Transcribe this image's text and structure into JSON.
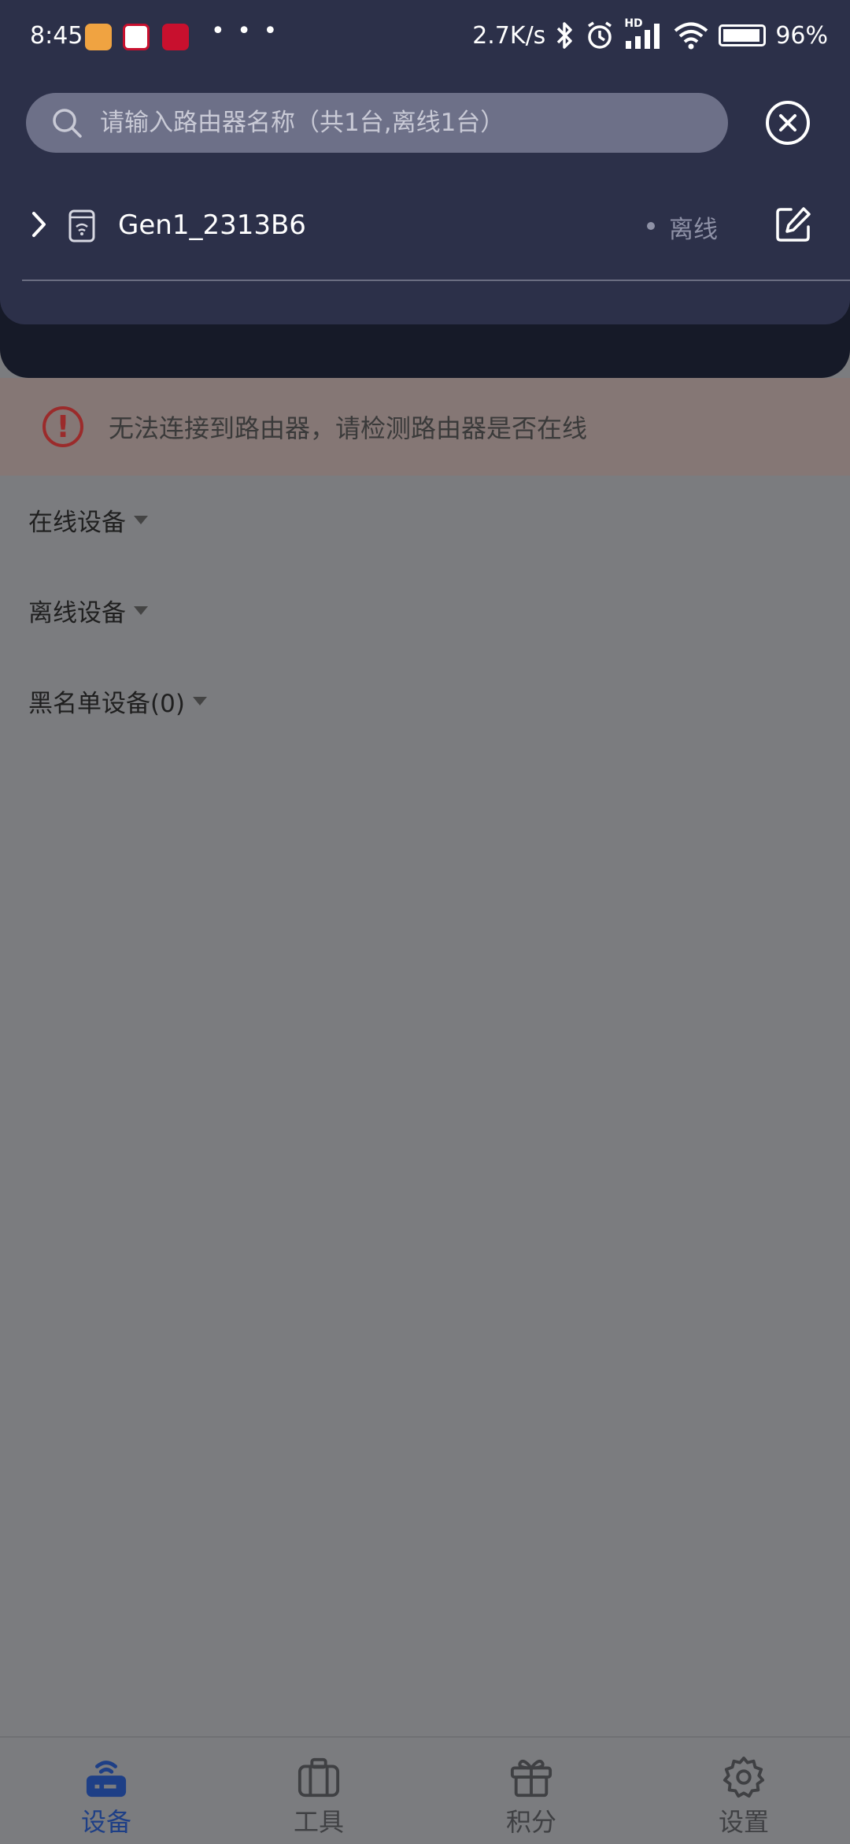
{
  "status_bar": {
    "time": "8:45",
    "more": "• • •",
    "net_speed": "2.7K/s",
    "signal_tag": "HD",
    "battery": "96%",
    "battery_level": 0.96,
    "app_icons": [
      "orange-app-icon",
      "bank-app-icon",
      "red-app-icon"
    ]
  },
  "search": {
    "placeholder": "请输入路由器名称（共1台,离线1台）"
  },
  "router": {
    "name": "Gen1_2313B6",
    "status": "离线"
  },
  "error_banner": {
    "message": "无法连接到路由器，请检测路由器是否在线",
    "icon": "!"
  },
  "groups": {
    "online": "在线设备",
    "offline": "离线设备",
    "blacklist": "黑名单设备(0)"
  },
  "bottom_nav": [
    {
      "label": "设备",
      "icon": "router-icon",
      "active": true
    },
    {
      "label": "工具",
      "icon": "toolbox-icon",
      "active": false
    },
    {
      "label": "积分",
      "icon": "gift-icon",
      "active": false
    },
    {
      "label": "设置",
      "icon": "gear-icon",
      "active": false
    }
  ],
  "colors": {
    "panel": "#2c3049",
    "overlay": "#7b7c7f",
    "accent": "#1e3f86",
    "error": "#9b2b2b"
  }
}
